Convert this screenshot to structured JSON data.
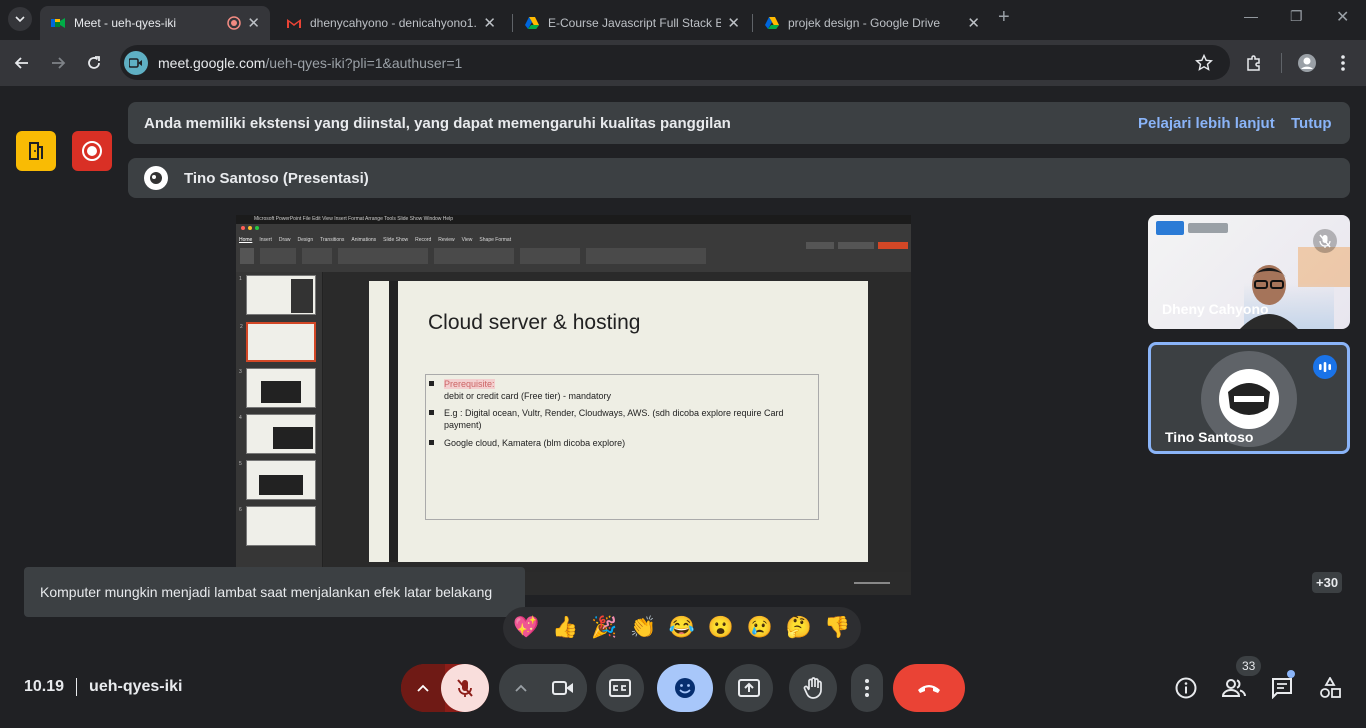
{
  "browser": {
    "tabs": [
      {
        "title": "Meet - ueh-qyes-iki",
        "active": true
      },
      {
        "title": "dhenycahyono - denicahyono1...",
        "active": false
      },
      {
        "title": "E-Course Javascript Full Stack B...",
        "active": false
      },
      {
        "title": "projek design - Google Drive",
        "active": false
      }
    ],
    "url_host": "meet.google.com",
    "url_path": "/ueh-qyes-iki?pli=1&authuser=1"
  },
  "banner": {
    "message": "Anda memiliki ekstensi yang diinstal, yang dapat memengaruhi kualitas panggilan",
    "learn_more": "Pelajari lebih lanjut",
    "close": "Tutup"
  },
  "presenter": {
    "label": "Tino Santoso (Presentasi)"
  },
  "slide": {
    "title": "Cloud server & hosting",
    "bullet1_label": "Prerequisite:",
    "bullet1_text": "debit or credit card (Free tier) - mandatory",
    "bullet2": "E.g : Digital ocean, Vultr, Render, Cloudways, AWS. (sdh dicoba explore require Card payment)",
    "bullet3": "Google cloud, Kamatera (blm dicoba explore)"
  },
  "ppt": {
    "app_menu": "Microsoft PowerPoint   File   Edit   View   Insert   Format   Arrange   Tools   Slide Show   Window   Help",
    "ribbon_tabs": [
      "Home",
      "Insert",
      "Draw",
      "Design",
      "Transitions",
      "Animations",
      "Slide Show",
      "Record",
      "Review",
      "View",
      "Shape Format"
    ]
  },
  "participants": [
    {
      "name": "Dheny Cahyono"
    },
    {
      "name": "Tino Santoso"
    }
  ],
  "more_participants": "+30",
  "toast": "Komputer mungkin menjadi lambat saat menjalankan efek latar belakang",
  "reactions": [
    "💖",
    "👍",
    "🎉",
    "👏",
    "😂",
    "😮",
    "😢",
    "🤔",
    "👎"
  ],
  "meeting": {
    "time": "10.19",
    "code": "ueh-qyes-iki"
  },
  "people_count": "33",
  "colors": {
    "end_call": "#ea4335",
    "accent": "#8ab4f8",
    "active_btn": "#a8c7fa",
    "mic_off": "#8c1d18"
  }
}
